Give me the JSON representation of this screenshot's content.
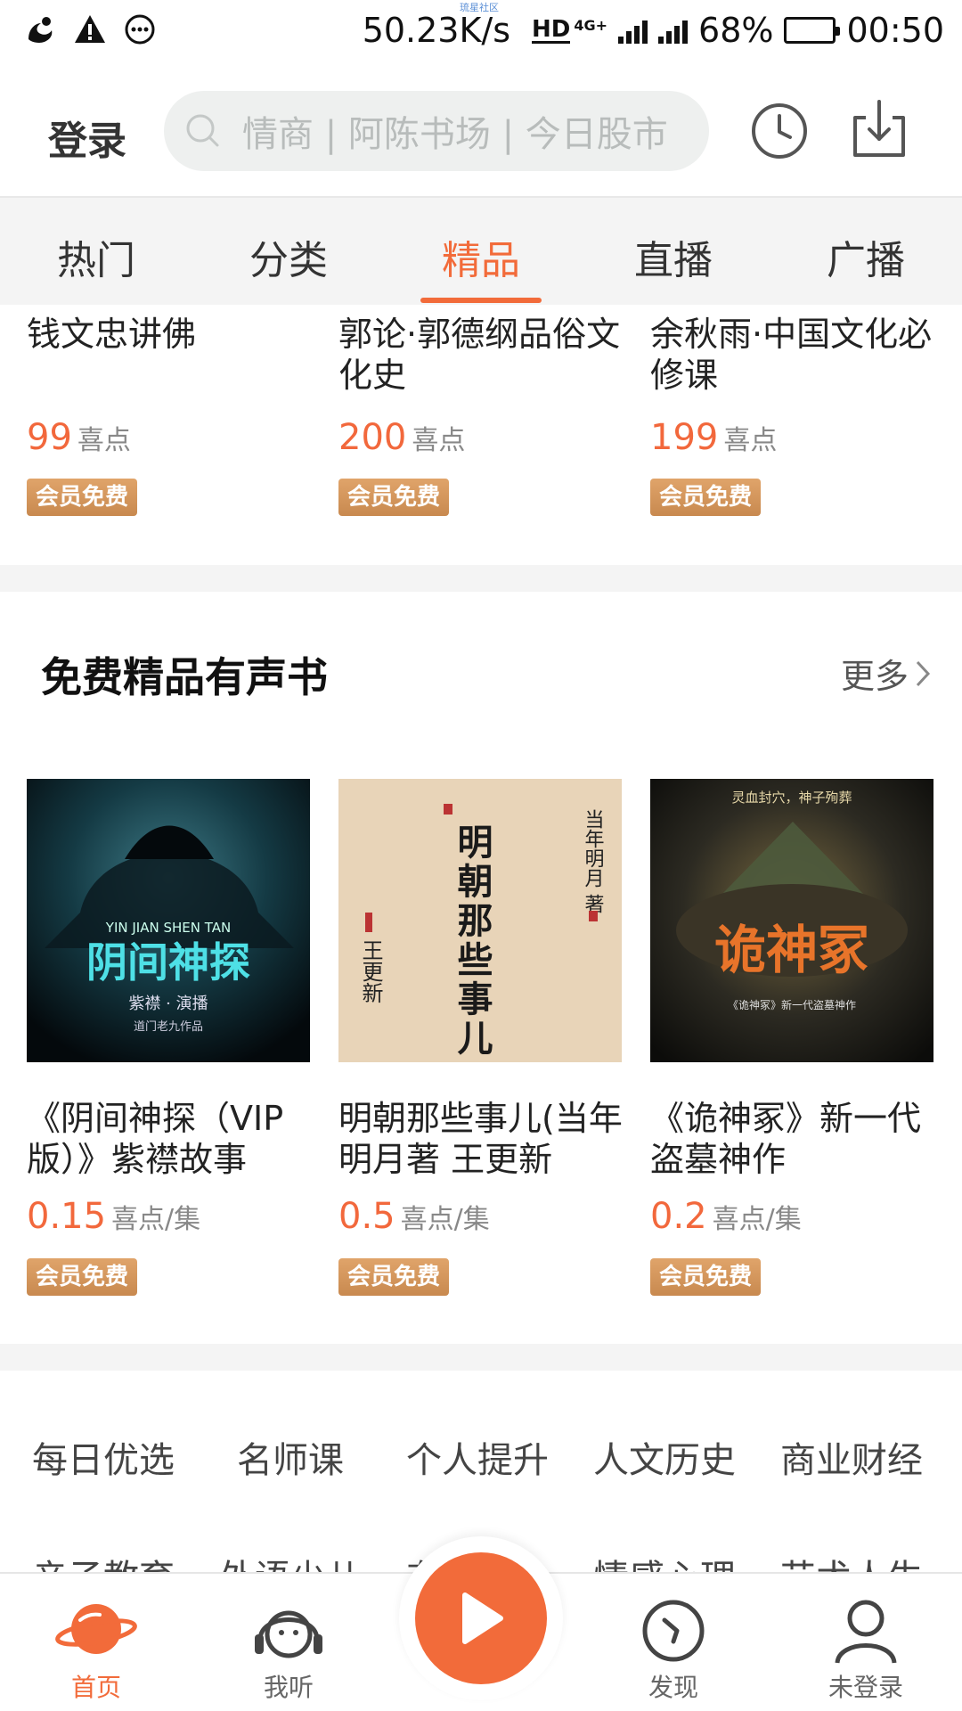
{
  "status_bar": {
    "watermark": "琉星社区",
    "net_speed": "50.23K/s",
    "hd": "HD",
    "network_type": "4G+",
    "battery_percent": "68%",
    "battery_level": 0.68,
    "time": "00:50"
  },
  "header": {
    "login_label": "登录",
    "search_placeholder": "情商 | 阿陈书场 | 今日股市",
    "icons": [
      "history-icon",
      "download-icon"
    ]
  },
  "tabs": [
    {
      "label": "热门",
      "active": false
    },
    {
      "label": "分类",
      "active": false
    },
    {
      "label": "精品",
      "active": true
    },
    {
      "label": "直播",
      "active": false
    },
    {
      "label": "广播",
      "active": false
    }
  ],
  "top_items": [
    {
      "title": "钱文忠讲佛",
      "price": "99",
      "unit": "喜点",
      "badge": "会员免费"
    },
    {
      "title": "郭论·郭德纲品俗文化史",
      "price": "200",
      "unit": "喜点",
      "badge": "会员免费"
    },
    {
      "title": "余秋雨·中国文化必修课",
      "price": "199",
      "unit": "喜点",
      "badge": "会员免费"
    }
  ],
  "free_section": {
    "title": "免费精品有声书",
    "more_label": "更多",
    "items": [
      {
        "title": "《阴间神探（VIP版）》紫襟故事",
        "price": "0.15",
        "unit": "喜点/集",
        "badge": "会员免费",
        "cover": {
          "subtitle": "YIN  JIAN  SHEN  TAN",
          "name": "阴间神探",
          "caption": "紫襟 · 演播",
          "caption2": "道门老九作品"
        }
      },
      {
        "title": "明朝那些事儿(当年明月著 王更新",
        "price": "0.5",
        "unit": "喜点/集",
        "badge": "会员免费",
        "cover": {
          "name": "明朝那些事儿",
          "author": "当年明月 著",
          "narrator": "王更新"
        }
      },
      {
        "title": "《诡神冢》新一代盗墓神作",
        "price": "0.2",
        "unit": "喜点/集",
        "badge": "会员免费",
        "cover": {
          "tagline": "灵血封穴，神子殉葬",
          "name": "诡神冢",
          "caption": "《诡神冢》新一代盗墓神作"
        }
      }
    ]
  },
  "category_tags": [
    "每日优选",
    "名师课",
    "个人提升",
    "人文历史",
    "商业财经",
    "亲子教育",
    "外语少儿",
    "有声书",
    "情感心理",
    "艺术人生"
  ],
  "bottom_nav": [
    {
      "label": "首页",
      "icon": "planet-icon",
      "active": true
    },
    {
      "label": "我听",
      "icon": "headphones-icon",
      "active": false
    },
    {
      "label": "",
      "icon": "play-icon",
      "active": false
    },
    {
      "label": "发现",
      "icon": "compass-icon",
      "active": false
    },
    {
      "label": "未登录",
      "icon": "user-icon",
      "active": false
    }
  ]
}
